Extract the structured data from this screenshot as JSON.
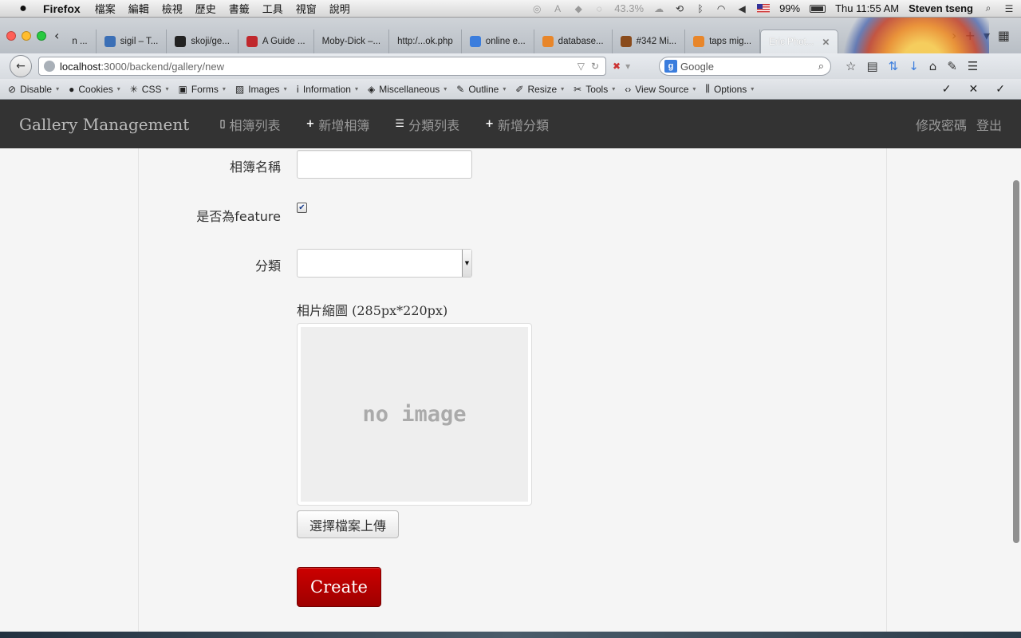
{
  "os_menubar": {
    "app": "Firefox",
    "menus": [
      "檔案",
      "編輯",
      "檢視",
      "歷史",
      "書籤",
      "工具",
      "視窗",
      "說明"
    ],
    "percent_indicator": "43.3%",
    "battery": "99%",
    "clock": "Thu 11:55 AM",
    "user": "Steven tseng"
  },
  "browser": {
    "tabs": [
      {
        "label": "n ...",
        "fav_color": "#ffffff"
      },
      {
        "label": "sigil – T...",
        "fav_color": "#3b6fb6"
      },
      {
        "label": "skoji/ge...",
        "fav_color": "#222222"
      },
      {
        "label": "A Guide ...",
        "fav_color": "#c0282d"
      },
      {
        "label": "Moby-Dick –...",
        "fav_color": "#dddddd"
      },
      {
        "label": "http:/...ok.php",
        "fav_color": "#dddddd"
      },
      {
        "label": "online e...",
        "fav_color": "#3b7ddd"
      },
      {
        "label": "database...",
        "fav_color": "#e8862a"
      },
      {
        "label": "#342 Mi...",
        "fav_color": "#8a4b1c"
      },
      {
        "label": "taps mig...",
        "fav_color": "#e8862a"
      },
      {
        "label": "Eric Phot...",
        "fav_color": "#ffffff",
        "active": true
      }
    ],
    "url_host": "localhost",
    "url_path": ":3000/backend/gallery/new",
    "search_placeholder": "Google",
    "webdev_toolbar": [
      "Disable",
      "Cookies",
      "CSS",
      "Forms",
      "Images",
      "Information",
      "Miscellaneous",
      "Outline",
      "Resize",
      "Tools",
      "View Source",
      "Options"
    ]
  },
  "app_nav": {
    "brand": "Gallery Management",
    "links": [
      {
        "label": "相簿列表",
        "icon": "book-icon",
        "glyph": "▯"
      },
      {
        "label": "新增相簿",
        "icon": "plus-icon",
        "glyph": "+"
      },
      {
        "label": "分類列表",
        "icon": "list-icon",
        "glyph": "☰"
      },
      {
        "label": "新增分類",
        "icon": "plus-icon",
        "glyph": "+"
      }
    ],
    "right_links": [
      "修改密碼",
      "登出"
    ]
  },
  "form": {
    "name_label": "相簿名稱",
    "name_value": "",
    "feature_label": "是否為feature",
    "feature_checked": true,
    "category_label": "分類",
    "category_value": "",
    "thumbnail_label": "相片縮圖 (285px*220px)",
    "thumbnail_placeholder": "no image",
    "upload_label": "選擇檔案上傳",
    "submit_label": "Create"
  },
  "colors": {
    "navbar_bg": "#333333",
    "submit_bg": "#b00000",
    "page_bg": "#f5f5f5"
  }
}
